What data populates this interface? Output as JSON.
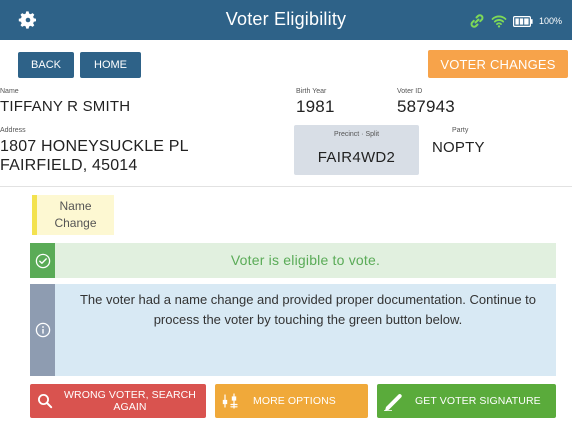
{
  "header": {
    "title": "Voter Eligibility",
    "battery_percent": "100%",
    "icons": [
      "gear-icon",
      "link-icon",
      "wifi-icon",
      "battery-icon"
    ],
    "background_color": "#2e6288"
  },
  "nav": {
    "back_label": "BACK",
    "home_label": "HOME",
    "voter_changes_label": "VOTER CHANGES"
  },
  "voter": {
    "name_label": "Name",
    "name": "TIFFANY R SMITH",
    "birth_year_label": "Birth Year",
    "birth_year": "1981",
    "voter_id_label": "Voter ID",
    "voter_id": "587943",
    "address_label": "Address",
    "address_line1": "1807 HONEYSUCKLE PL",
    "address_line2": "FAIRFIELD, 45014",
    "precinct_split_label": "Precinct · Split",
    "precinct_split": "FAIR4WD2",
    "party_label": "Party",
    "party": "NOPTY"
  },
  "flags": {
    "name_change_line1": "Name",
    "name_change_line2": "Change"
  },
  "messages": {
    "eligible": "Voter is eligible to vote.",
    "info": "The voter had a name change and provided proper documentation. Continue to process the voter by touching the green button below."
  },
  "actions": {
    "wrong_voter_line1": "WRONG VOTER, SEARCH",
    "wrong_voter_line2": "AGAIN",
    "more_options": "MORE OPTIONS",
    "get_signature": "GET VOTER SIGNATURE"
  },
  "colors": {
    "accent_blue": "#2e6288",
    "orange": "#f7a34a",
    "green": "#5aab3b",
    "red": "#d9534f",
    "yellow": "#f0a93a"
  }
}
